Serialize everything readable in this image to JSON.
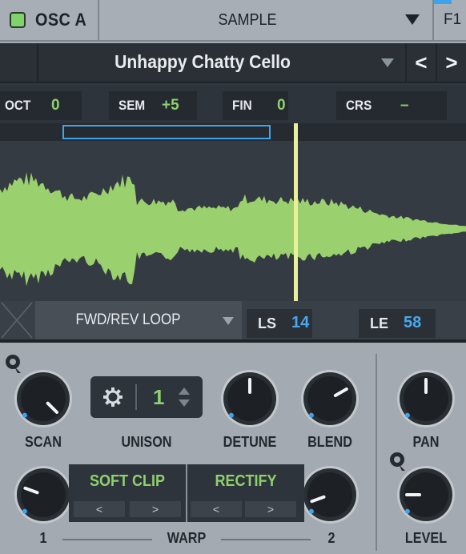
{
  "header": {
    "osc_label": "OSC A",
    "mode_label": "SAMPLE",
    "filter_label": "F1"
  },
  "sample": {
    "name": "Unhappy Chatty Cello",
    "prev_label": "<",
    "next_label": ">"
  },
  "params": [
    {
      "label": "OCT",
      "value": "0"
    },
    {
      "label": "SEM",
      "value": "+5"
    },
    {
      "label": "FIN",
      "value": "0"
    },
    {
      "label": "CRS",
      "value": "–"
    }
  ],
  "loop": {
    "mode": "FWD/REV LOOP",
    "ls_label": "LS",
    "ls_value": "14",
    "le_label": "LE",
    "le_value": "58"
  },
  "knobs": {
    "scan": "SCAN",
    "unison": "UNISON",
    "detune": "DETUNE",
    "blend": "BLEND",
    "pan": "PAN",
    "level": "LEVEL"
  },
  "unison": {
    "value": "1"
  },
  "warp": {
    "label": "WARP",
    "slot1": "1",
    "slot2": "2",
    "fx1": "SOFT CLIP",
    "fx2": "RECTIFY",
    "prev": "<",
    "next": ">"
  },
  "colors": {
    "accent_green": "#8fd06e",
    "accent_blue": "#3ea4ef",
    "waveform": "#9ad06e",
    "playhead": "#eaf09a"
  }
}
